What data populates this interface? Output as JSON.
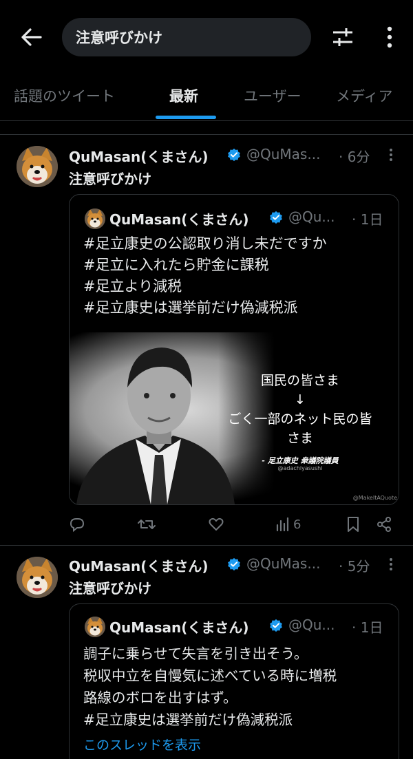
{
  "search": {
    "query": "注意呼びかけ"
  },
  "tabs": [
    {
      "label": "話題のツイート"
    },
    {
      "label": "最新"
    },
    {
      "label": "ユーザー"
    },
    {
      "label": "メディア"
    }
  ],
  "colors": {
    "accent": "#1d9bf0",
    "background": "#000000",
    "muted": "#71767b",
    "text": "#e7e9ea"
  },
  "tweets": [
    {
      "name": "QuMasan(くまさん)",
      "handle": "@QuMas...",
      "time": "· 6分",
      "text": "注意呼びかけ",
      "quote": {
        "name": "QuMasan(くまさん)",
        "handle": "@Qu...",
        "time": "· 1日",
        "lines": [
          "#足立康史の公認取り消し未だですか",
          "#足立に入れたら貯金に課税",
          "#足立より減税",
          "#足立康史は選挙前だけ偽減税派"
        ],
        "image": {
          "line1": "国民の皆さま",
          "arrow": "↓",
          "line2": "ごく一部のネット民の皆",
          "line3": "さま",
          "attribution": "- 足立康史 衆議院議員",
          "handle": "@adachiyasushi",
          "watermark": "@MakeItAQuote"
        }
      },
      "views": "6"
    },
    {
      "name": "QuMasan(くまさん)",
      "handle": "@QuMas...",
      "time": "· 5分",
      "text": "注意呼びかけ",
      "quote": {
        "name": "QuMasan(くまさん)",
        "handle": "@Qu...",
        "time": "· 1日",
        "lines": [
          "調子に乗らせて失言を引き出そう。",
          "税収中立を自慢気に述べている時に増税",
          "路線のボロを出すはず。",
          "#足立康史は選挙前だけ偽減税派"
        ],
        "thread_link": "このスレッドを表示"
      }
    }
  ]
}
